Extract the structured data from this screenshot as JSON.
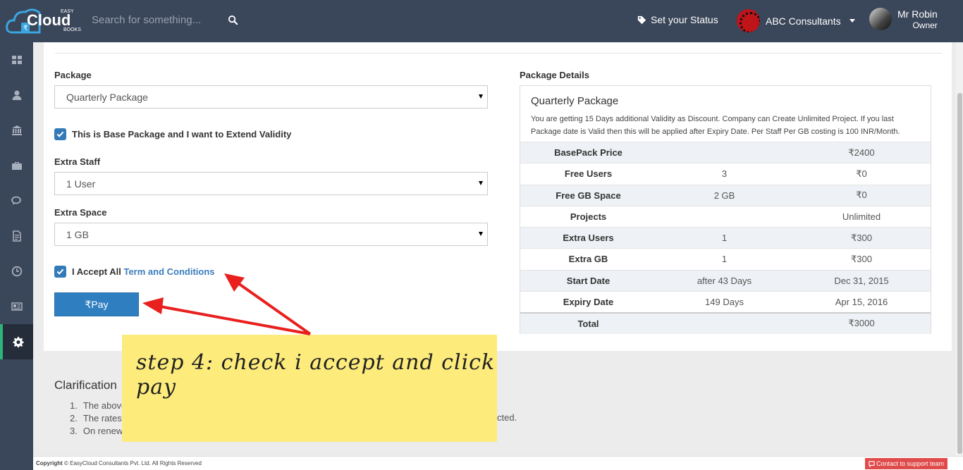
{
  "header": {
    "logo_top": "EASY",
    "logo_main": "Cloud",
    "logo_sub": "BOOKS",
    "search_placeholder": "Search for something...",
    "status_label": "Set your Status",
    "company_name": "ABC Consultants",
    "user_name": "Mr Robin",
    "user_role": "Owner"
  },
  "sidebar": {
    "items": [
      {
        "icon": "dashboard-icon"
      },
      {
        "icon": "user-icon"
      },
      {
        "icon": "bank-icon"
      },
      {
        "icon": "briefcase-icon"
      },
      {
        "icon": "chat-icon"
      },
      {
        "icon": "document-icon"
      },
      {
        "icon": "clock-icon"
      },
      {
        "icon": "newspaper-icon"
      },
      {
        "icon": "gear-icon",
        "active": true
      }
    ]
  },
  "form": {
    "package_label": "Package",
    "package_value": "Quarterly Package",
    "base_package_check": "This is Base Package and I want to Extend Validity",
    "extra_staff_label": "Extra Staff",
    "extra_staff_value": "1 User",
    "extra_space_label": "Extra Space",
    "extra_space_value": "1 GB",
    "accept_text": "I Accept All",
    "accept_link": "Term and Conditions",
    "pay_label": "₹Pay"
  },
  "details": {
    "title": "Package Details",
    "package_name": "Quarterly Package",
    "description": "You are getting 15 Days additional Validity as Discount. Company can Create Unlimited Project. If you last Package date is Valid then this will be applied after Expiry Date. Per Staff Per GB costing is 100 INR/Month.",
    "rows": [
      {
        "key": "BasePack Price",
        "mid": "",
        "value": "₹2400"
      },
      {
        "key": "Free Users",
        "mid": "3",
        "value": "₹0"
      },
      {
        "key": "Free GB Space",
        "mid": "2 GB",
        "value": "₹0"
      },
      {
        "key": "Projects",
        "mid": "",
        "value": "Unlimited"
      },
      {
        "key": "Extra Users",
        "mid": "1",
        "value": "₹300"
      },
      {
        "key": "Extra GB",
        "mid": "1",
        "value": "₹300"
      },
      {
        "key": "Start Date",
        "mid": "after 43 Days",
        "value": "Dec 31, 2015"
      },
      {
        "key": "Expiry Date",
        "mid": "149 Days",
        "value": "Apr 15, 2016"
      },
      {
        "key": "Total",
        "mid": "",
        "value": "₹3000"
      }
    ]
  },
  "clarifications": {
    "title": "Clarification",
    "items": [
      {
        "num": "1.",
        "text": "The above"
      },
      {
        "num": "2.",
        "text": "The rates"
      },
      {
        "num": "3.",
        "text": "On renew"
      }
    ],
    "tail": "cted."
  },
  "annotation": {
    "note_text": "step 4: check i accept and click pay"
  },
  "footer": {
    "copyright_bold": "Copyright",
    "copyright_text": "© EasyCloud Consultants Pvt. Ltd. All Rights Reserved",
    "support_label": "Contact to support team"
  },
  "colors": {
    "topbar": "#3a4659",
    "accent": "#2f7ec0",
    "active_marker": "#2cb57a",
    "note": "#fdec7c",
    "arrow": "#e8201e"
  }
}
